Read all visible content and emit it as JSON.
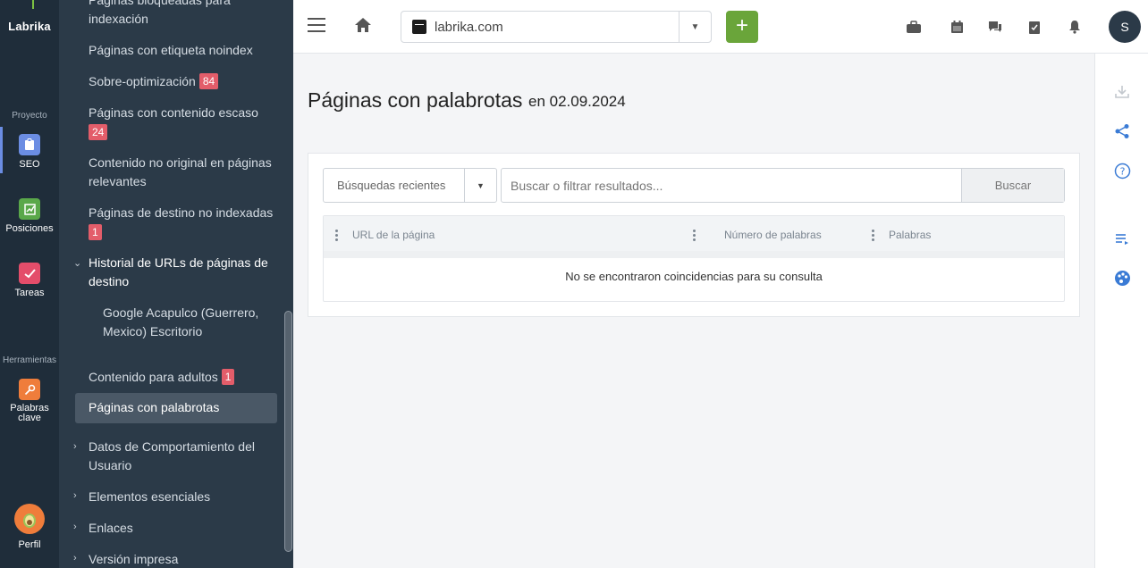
{
  "rail": {
    "logo": "Labrika",
    "section_project": "Proyecto",
    "section_tools": "Herramientas",
    "items": [
      {
        "label": "SEO"
      },
      {
        "label": "Posiciones"
      },
      {
        "label": "Tareas"
      },
      {
        "label": "Palabras clave"
      },
      {
        "label": "Perfil"
      }
    ]
  },
  "sidebar": {
    "items": [
      {
        "label": "Páginas bloqueadas para indexación"
      },
      {
        "label": "Páginas con etiqueta noindex"
      },
      {
        "label": "Sobre-optimización",
        "badge": "84"
      },
      {
        "label": "Páginas con contenido escaso",
        "badge": "24"
      },
      {
        "label": "Contenido no original en páginas relevantes"
      },
      {
        "label": "Páginas de destino no indexadas",
        "badge": "1"
      },
      {
        "label": "Historial de URLs de páginas de destino"
      },
      {
        "label": "Google Acapulco (Guerrero, Mexico) Escritorio"
      },
      {
        "label": "Contenido para adultos",
        "badge": "1"
      },
      {
        "label": "Páginas con palabrotas"
      },
      {
        "label": "Datos de Comportamiento del Usuario"
      },
      {
        "label": "Elementos esenciales"
      },
      {
        "label": "Enlaces"
      },
      {
        "label": "Versión impresa"
      }
    ]
  },
  "topbar": {
    "project_name": "labrika.com",
    "add_label": "+",
    "user_initial": "S"
  },
  "page": {
    "title": "Páginas con palabrotas",
    "date": "en 02.09.2024"
  },
  "filters": {
    "recent_label": "Búsquedas recientes",
    "search_placeholder": "Buscar o filtrar resultados...",
    "search_button": "Buscar"
  },
  "table": {
    "columns": [
      "URL de la página",
      "Número de palabras",
      "Palabras"
    ],
    "empty_message": "No se encontraron coincidencias para su consulta"
  },
  "colors": {
    "rail_bg": "#1f2d3a",
    "sidebar_bg": "#2b3a48",
    "accent_green": "#6aa53a",
    "badge_red": "#e35d6a",
    "link_blue": "#3a7bd5"
  }
}
